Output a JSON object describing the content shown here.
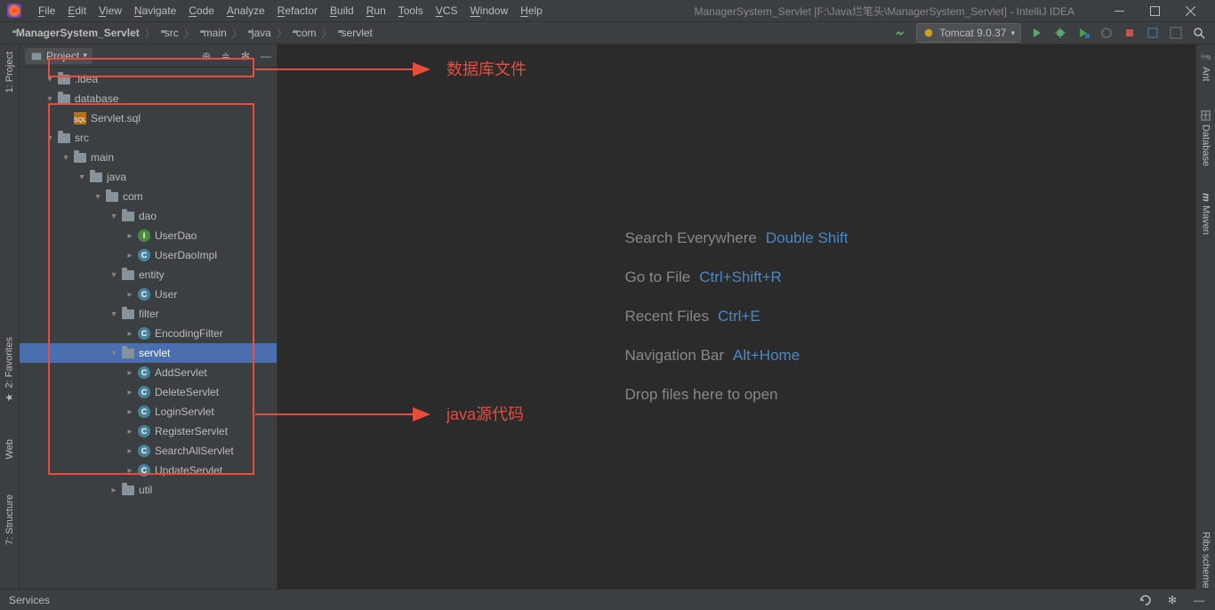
{
  "window": {
    "title": "ManagerSystem_Servlet [F:\\Java烂笔头\\ManagerSystem_Servlet] - IntelliJ IDEA",
    "menus": [
      "File",
      "Edit",
      "View",
      "Navigate",
      "Code",
      "Analyze",
      "Refactor",
      "Build",
      "Run",
      "Tools",
      "VCS",
      "Window",
      "Help"
    ]
  },
  "navbar": {
    "crumbs": [
      "ManagerSystem_Servlet",
      "src",
      "main",
      "java",
      "com",
      "servlet"
    ],
    "run_config": "Tomcat 9.0.37"
  },
  "panel": {
    "title": "Project",
    "left_tabs": [
      "1: Project",
      "2: Favorites",
      "Web",
      "7: Structure"
    ],
    "right_tabs": [
      "Ant",
      "Database",
      "Maven",
      "Ribs scheme"
    ]
  },
  "tree": [
    {
      "d": 1,
      "a": "▾",
      "t": "folder",
      "l": ".idea"
    },
    {
      "d": 1,
      "a": "▾",
      "t": "folder",
      "l": "database"
    },
    {
      "d": 2,
      "a": "",
      "t": "sql",
      "l": "Servlet.sql"
    },
    {
      "d": 1,
      "a": "▾",
      "t": "folder",
      "l": "src"
    },
    {
      "d": 2,
      "a": "▾",
      "t": "folder",
      "l": "main"
    },
    {
      "d": 3,
      "a": "▾",
      "t": "folder",
      "l": "java"
    },
    {
      "d": 4,
      "a": "▾",
      "t": "folder",
      "l": "com"
    },
    {
      "d": 5,
      "a": "▾",
      "t": "folder",
      "l": "dao"
    },
    {
      "d": 6,
      "a": "▸",
      "t": "iface",
      "l": "UserDao"
    },
    {
      "d": 6,
      "a": "▸",
      "t": "class",
      "l": "UserDaoImpl"
    },
    {
      "d": 5,
      "a": "▾",
      "t": "folder",
      "l": "entity"
    },
    {
      "d": 6,
      "a": "▸",
      "t": "class",
      "l": "User"
    },
    {
      "d": 5,
      "a": "▾",
      "t": "folder",
      "l": "filter"
    },
    {
      "d": 6,
      "a": "▸",
      "t": "class",
      "l": "EncodingFilter"
    },
    {
      "d": 5,
      "a": "▾",
      "t": "folder",
      "l": "servlet",
      "sel": true
    },
    {
      "d": 6,
      "a": "▸",
      "t": "class",
      "l": "AddServlet"
    },
    {
      "d": 6,
      "a": "▸",
      "t": "class",
      "l": "DeleteServlet"
    },
    {
      "d": 6,
      "a": "▸",
      "t": "class",
      "l": "LoginServlet"
    },
    {
      "d": 6,
      "a": "▸",
      "t": "class",
      "l": "RegisterServlet"
    },
    {
      "d": 6,
      "a": "▸",
      "t": "class",
      "l": "SearchAllServlet"
    },
    {
      "d": 6,
      "a": "▸",
      "t": "class",
      "l": "UpdateServlet"
    },
    {
      "d": 5,
      "a": "▸",
      "t": "folder",
      "l": "util"
    }
  ],
  "welcome": [
    {
      "label": "Search Everywhere",
      "key": "Double Shift"
    },
    {
      "label": "Go to File",
      "key": "Ctrl+Shift+R"
    },
    {
      "label": "Recent Files",
      "key": "Ctrl+E"
    },
    {
      "label": "Navigation Bar",
      "key": "Alt+Home"
    },
    {
      "label": "Drop files here to open",
      "key": ""
    }
  ],
  "annotations": {
    "db_label": "数据库文件",
    "src_label": "java源代码"
  },
  "statusbar": {
    "left": "Services"
  }
}
